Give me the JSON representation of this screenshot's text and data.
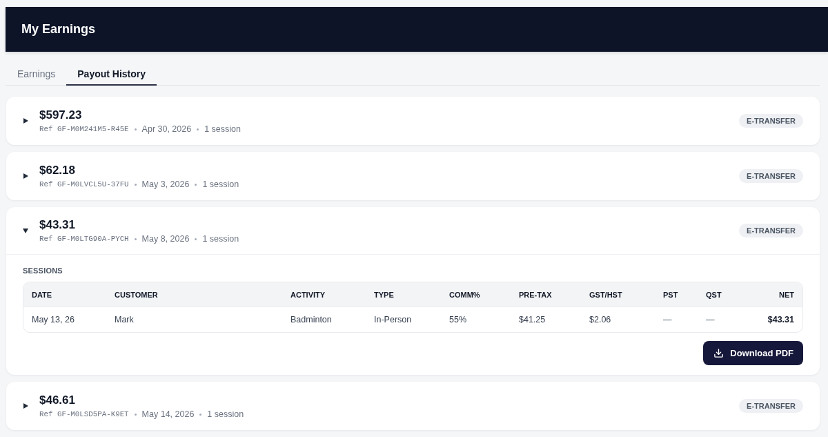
{
  "header": {
    "title": "My Earnings"
  },
  "tabs": [
    {
      "label": "Earnings",
      "selected": false
    },
    {
      "label": "Payout History",
      "selected": true
    }
  ],
  "payouts": [
    {
      "amount": "$597.23",
      "ref": "Ref GF-M0M241M5-R45E",
      "date": "Apr 30, 2026",
      "sessions_count": "1 session",
      "method": "E-TRANSFER",
      "expanded": false
    },
    {
      "amount": "$62.18",
      "ref": "Ref GF-M0LVCL5U-37FU",
      "date": "May 3, 2026",
      "sessions_count": "1 session",
      "method": "E-TRANSFER",
      "expanded": false
    },
    {
      "amount": "$43.31",
      "ref": "Ref GF-M0LTG90A-PYCH",
      "date": "May 8, 2026",
      "sessions_count": "1 session",
      "method": "E-TRANSFER",
      "expanded": true,
      "details": {
        "section_title": "SESSIONS",
        "table": {
          "columns": [
            "DATE",
            "CUSTOMER",
            "ACTIVITY",
            "TYPE",
            "COMM%",
            "PRE-TAX",
            "GST/HST",
            "PST",
            "QST",
            "NET"
          ],
          "rows": [
            [
              "May 13, 26",
              "Mark",
              "Badminton",
              "In-Person",
              "55%",
              "$41.25",
              "$2.06",
              "—",
              "—",
              "$43.31"
            ]
          ]
        },
        "download_button": "Download PDF"
      }
    },
    {
      "amount": "$46.61",
      "ref": "Ref GF-M0LSD5PA-K9ET",
      "date": "May 14, 2026",
      "sessions_count": "1 session",
      "method": "E-TRANSFER",
      "expanded": false
    }
  ]
}
